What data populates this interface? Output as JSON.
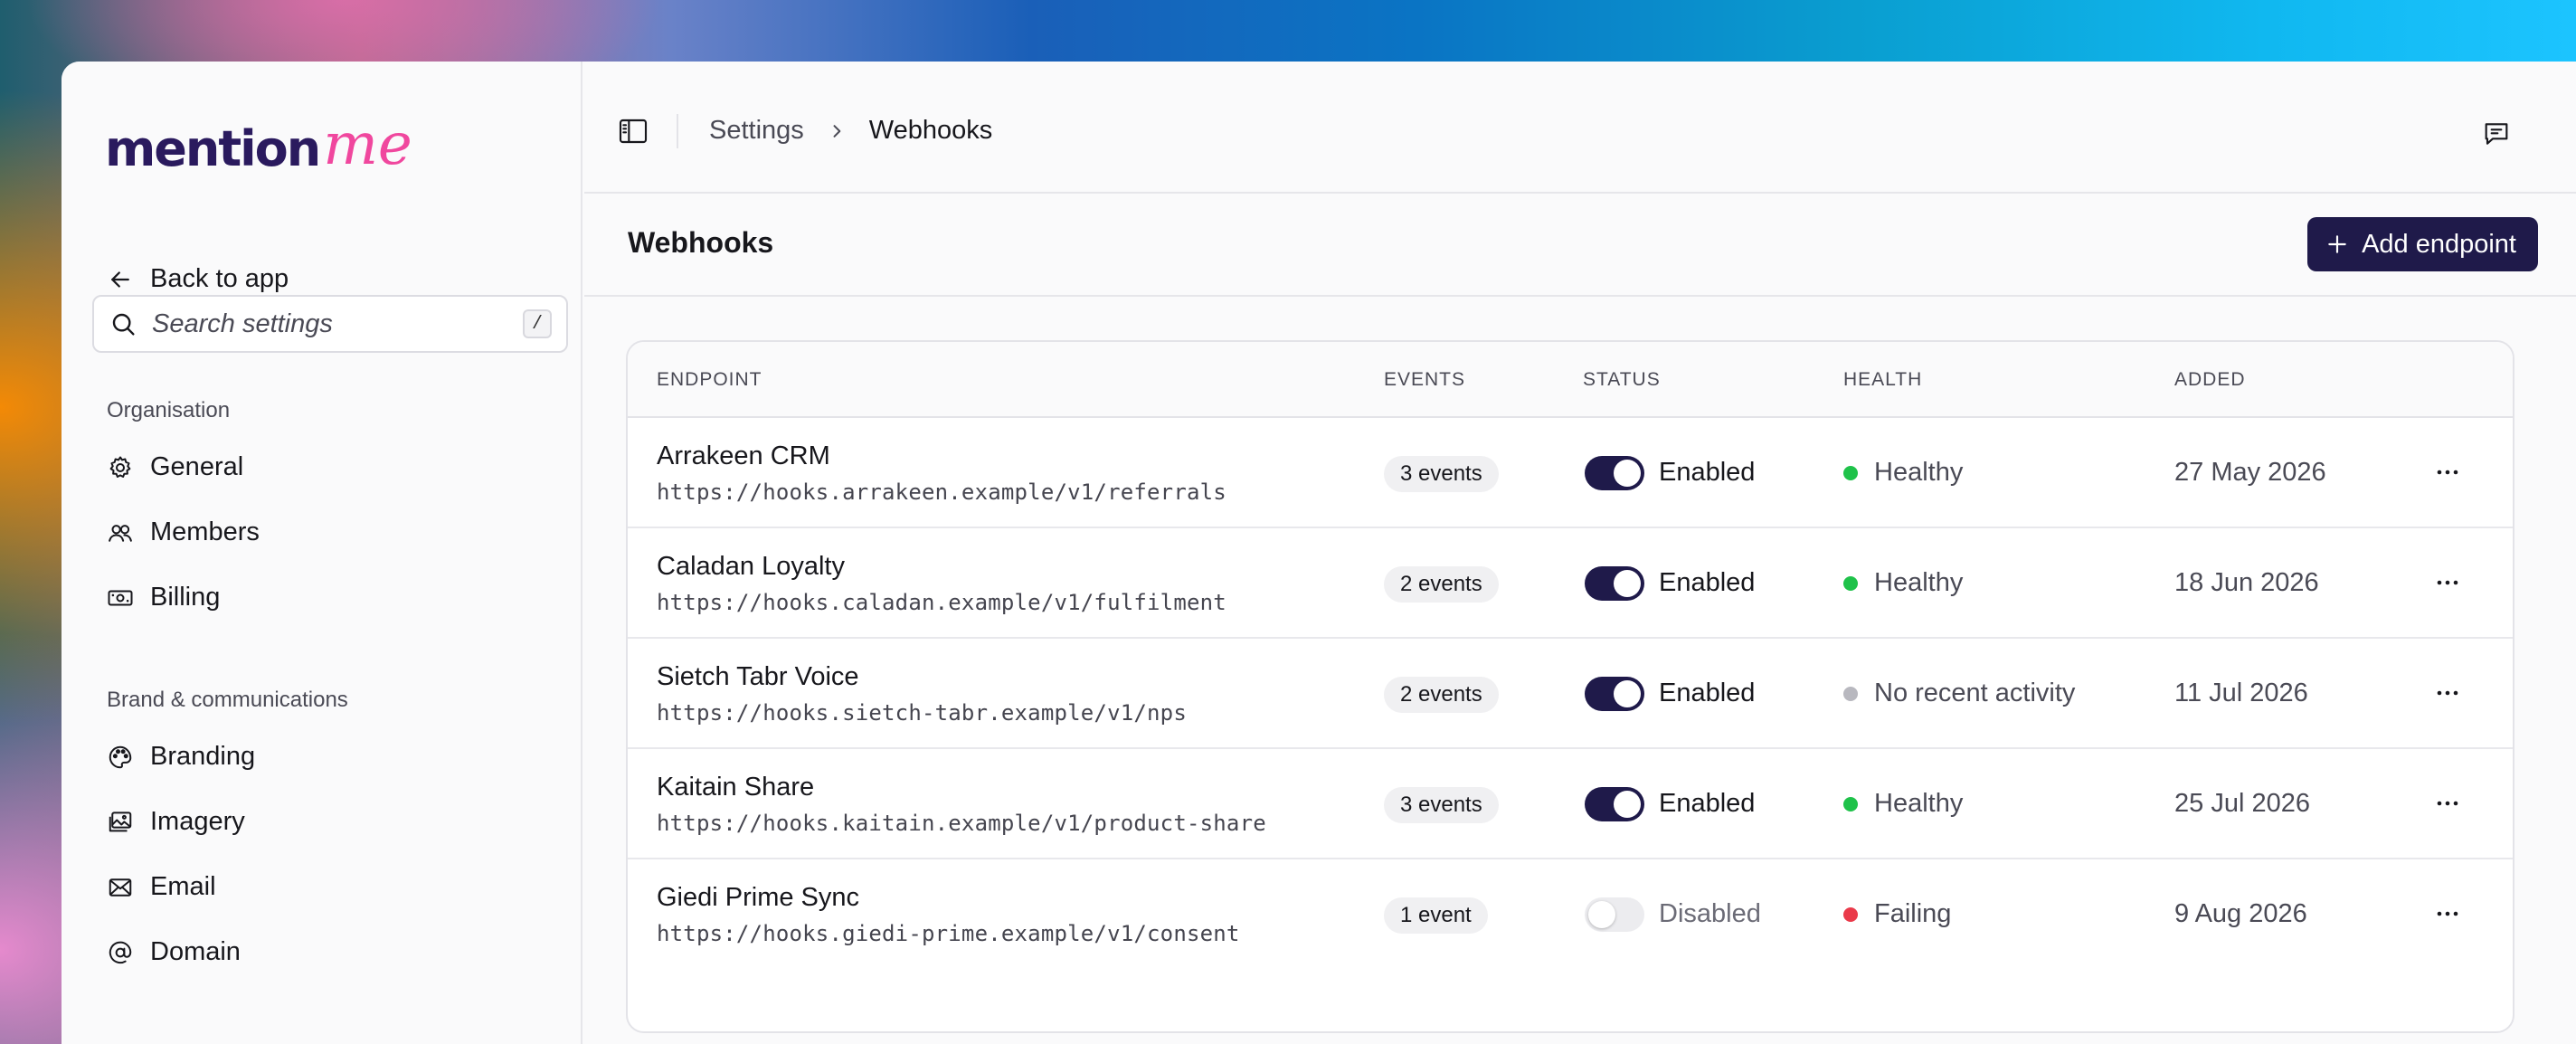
{
  "brand": {
    "logo_primary": "mention",
    "logo_accent": "me",
    "primary_color": "#2a1a5e",
    "accent_color": "#f0479e"
  },
  "sidebar": {
    "back_label": "Back to app",
    "search": {
      "placeholder": "Search settings",
      "shortcut": "/"
    },
    "sections": [
      {
        "label": "Organisation",
        "items": [
          {
            "label": "General",
            "icon": "gear-icon"
          },
          {
            "label": "Members",
            "icon": "users-icon"
          },
          {
            "label": "Billing",
            "icon": "banknote-icon"
          }
        ]
      },
      {
        "label": "Brand & communications",
        "items": [
          {
            "label": "Branding",
            "icon": "palette-icon"
          },
          {
            "label": "Imagery",
            "icon": "images-icon"
          },
          {
            "label": "Email",
            "icon": "mail-icon"
          },
          {
            "label": "Domain",
            "icon": "at-sign-icon"
          }
        ]
      }
    ]
  },
  "topbar": {
    "breadcrumb": [
      "Settings",
      "Webhooks"
    ]
  },
  "page": {
    "title": "Webhooks",
    "add_button": "Add endpoint",
    "button_color": "#1f1a4a"
  },
  "table": {
    "headers": {
      "endpoint": "ENDPOINT",
      "events": "EVENTS",
      "status": "STATUS",
      "health": "HEALTH",
      "added": "ADDED"
    },
    "rows": [
      {
        "name": "Arrakeen CRM",
        "url": "https://hooks.arrakeen.example/v1/referrals",
        "events": "3 events",
        "enabled": true,
        "status": "Enabled",
        "health": "Healthy",
        "health_color": "#1fc24a",
        "added": "27 May 2026"
      },
      {
        "name": "Caladan Loyalty",
        "url": "https://hooks.caladan.example/v1/fulfilment",
        "events": "2 events",
        "enabled": true,
        "status": "Enabled",
        "health": "Healthy",
        "health_color": "#1fc24a",
        "added": "18 Jun 2026"
      },
      {
        "name": "Sietch Tabr Voice",
        "url": "https://hooks.sietch-tabr.example/v1/nps",
        "events": "2 events",
        "enabled": true,
        "status": "Enabled",
        "health": "No recent activity",
        "health_color": "#b8b8bf",
        "added": "11 Jul 2026"
      },
      {
        "name": "Kaitain Share",
        "url": "https://hooks.kaitain.example/v1/product-share",
        "events": "3 events",
        "enabled": true,
        "status": "Enabled",
        "health": "Healthy",
        "health_color": "#1fc24a",
        "added": "25 Jul 2026"
      },
      {
        "name": "Giedi Prime Sync",
        "url": "https://hooks.giedi-prime.example/v1/consent",
        "events": "1 event",
        "enabled": false,
        "status": "Disabled",
        "health": "Failing",
        "health_color": "#ea3a4a",
        "added": "9 Aug 2026"
      }
    ]
  }
}
